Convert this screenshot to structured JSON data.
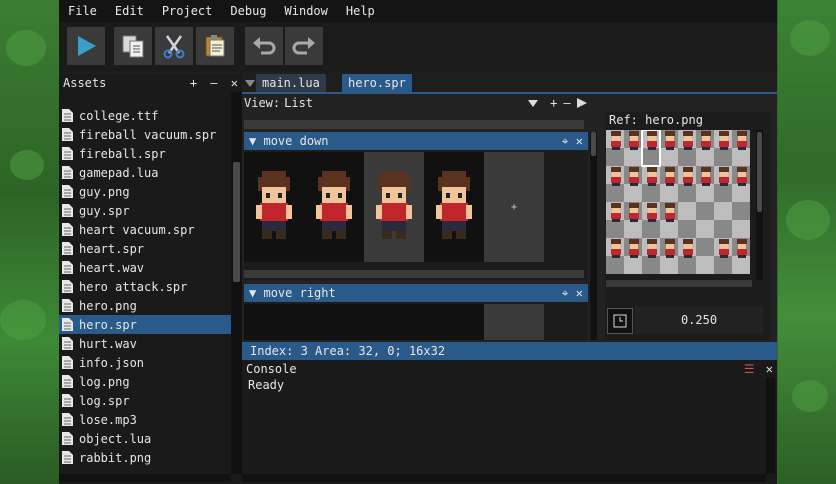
{
  "menu": [
    "File",
    "Edit",
    "Project",
    "Debug",
    "Window",
    "Help"
  ],
  "toolbar": {
    "buttons": [
      "play-icon",
      "copy-icon",
      "cut-icon",
      "paste-icon",
      "undo-icon",
      "redo-icon"
    ]
  },
  "assets": {
    "title": "Assets",
    "add": "+",
    "remove": "—",
    "close": "✕",
    "items": [
      "college.ttf",
      "fireball vacuum.spr",
      "fireball.spr",
      "gamepad.lua",
      "guy.png",
      "guy.spr",
      "heart vacuum.spr",
      "heart.spr",
      "heart.wav",
      "hero attack.spr",
      "hero.png",
      "hero.spr",
      "hurt.wav",
      "info.json",
      "log.png",
      "log.spr",
      "lose.mp3",
      "object.lua",
      "rabbit.png"
    ],
    "selected": "hero.spr"
  },
  "tabs": [
    "main.lua",
    "hero.spr"
  ],
  "view": {
    "label": "View:",
    "value": "List"
  },
  "animations": [
    {
      "name": "move down",
      "frames": 4
    },
    {
      "name": "move right",
      "frames": 4
    }
  ],
  "reference": {
    "label": "Ref: hero.png",
    "value": "0.250"
  },
  "status": {
    "text": "Index: 3   Area: 32, 0; 16x32"
  },
  "console": {
    "title": "Console",
    "lines": [
      "Ready"
    ]
  },
  "colors": {
    "accent": "#2a5a8a",
    "sprite_shirt": "#c0262c",
    "sprite_hair": "#5a3220"
  }
}
